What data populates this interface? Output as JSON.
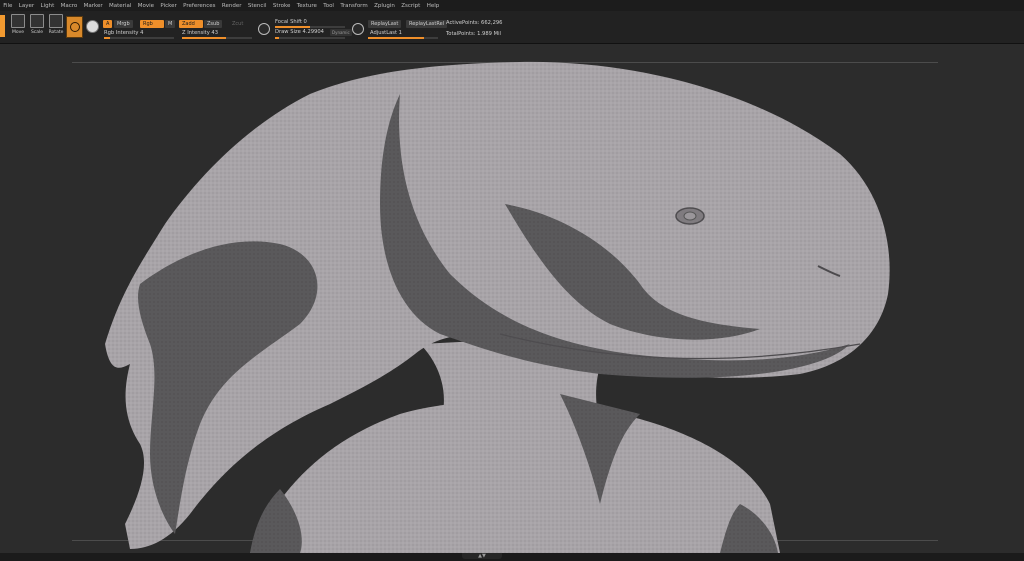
{
  "menu": [
    "File",
    "Layer",
    "Light",
    "Macro",
    "Marker",
    "Material",
    "Movie",
    "Picker",
    "Preferences",
    "Render",
    "Stencil",
    "Stroke",
    "Texture",
    "Tool",
    "Transform",
    "Zplugin",
    "Zscript",
    "Help"
  ],
  "toolbar": {
    "tool_buttons": [
      {
        "label": "Move",
        "icon": "move-icon"
      },
      {
        "label": "Scale",
        "icon": "scale-icon"
      },
      {
        "label": "Rotate",
        "icon": "rotate-icon"
      }
    ],
    "a_label": "A",
    "mrgb": "Mrgb",
    "rgb": "Rgb",
    "m": "M",
    "zadd": "Zadd",
    "zsub": "Zsub",
    "zcut": "Zcut",
    "rgb_intensity_label": "Rgb Intensity 4",
    "rgb_intensity": 4,
    "z_intensity_label": "Z Intensity 43",
    "z_intensity": 43,
    "focal_shift_label": "Focal Shift 0",
    "focal_shift": 0,
    "draw_size_label": "Draw Size 4.29904",
    "draw_size": 4.29904,
    "dynamic": "Dynamic",
    "replay_last": "ReplayLast",
    "replay_last_rel": "ReplayLastRel",
    "adjust_last_label": "AdjustLast 1",
    "adjust_last": 1,
    "active_points": "ActivePoints: 662,296",
    "total_points": "TotalPoints: 1.989 Mil"
  },
  "colors": {
    "accent": "#ef8f2a",
    "background": "#2c2c2c",
    "sculpt_light": "#a9a5a9",
    "sculpt_dark": "#5a595b"
  },
  "footer": {
    "toggle": "▲▼"
  }
}
